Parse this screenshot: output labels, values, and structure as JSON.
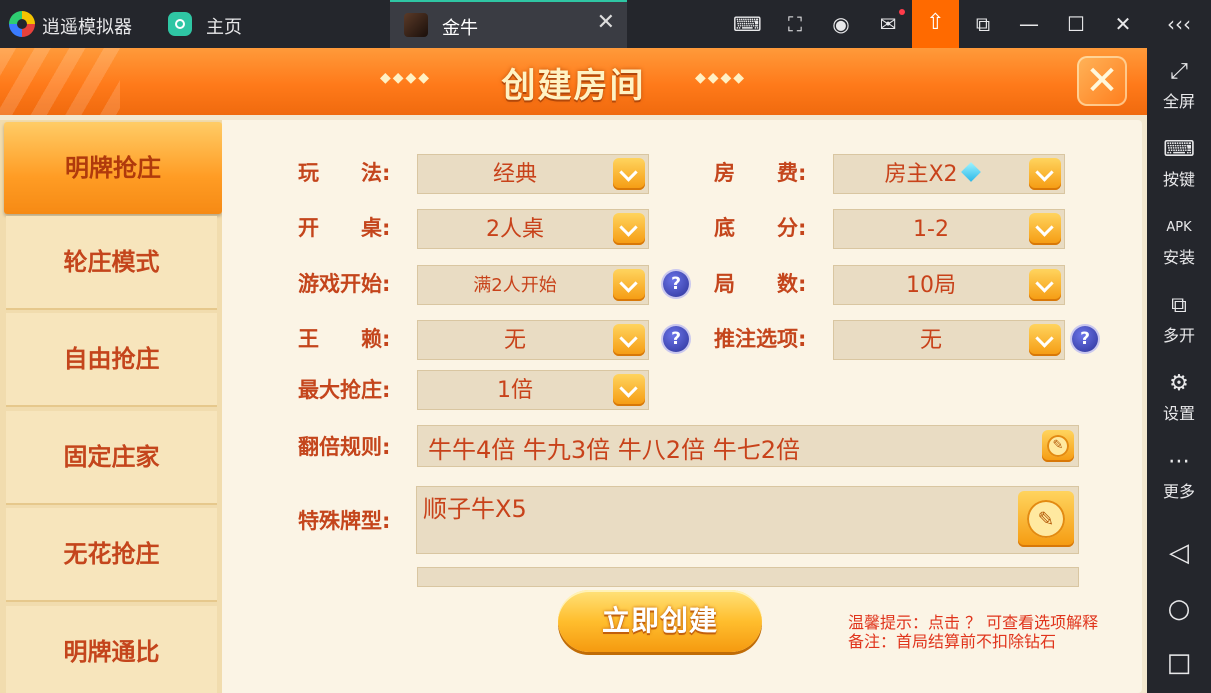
{
  "emulator": {
    "app_name": "逍遥模拟器",
    "home_label": "主页",
    "tab_label": "金牛",
    "sidebar": [
      "全屏",
      "按键",
      "安装",
      "多开",
      "设置",
      "更多"
    ]
  },
  "dialog": {
    "title": "创建房间",
    "title_deco_left": "◆◆◆◆",
    "title_deco_right": "◆◆◆◆"
  },
  "modes": [
    "明牌抢庄",
    "轮庄模式",
    "自由抢庄",
    "固定庄家",
    "无花抢庄",
    "明牌通比"
  ],
  "form": {
    "wanfa": {
      "label": "玩　　法:",
      "value": "经典"
    },
    "fangfei": {
      "label": "房　　费:",
      "value": "房主X2"
    },
    "kaizhuo": {
      "label": "开　　桌:",
      "value": "2人桌"
    },
    "difen": {
      "label": "底　　分:",
      "value": "1-2"
    },
    "start": {
      "label": "游戏开始:",
      "value": "满2人开始"
    },
    "jushu": {
      "label": "局　　数:",
      "value": "10局"
    },
    "wanglai": {
      "label": "王　　赖:",
      "value": "无"
    },
    "tuizhu": {
      "label": "推注选项:",
      "value": "无"
    },
    "qiangzhuang": {
      "label": "最大抢庄:",
      "value": "1倍"
    },
    "fanbei": {
      "label": "翻倍规则:",
      "value": "牛牛4倍 牛九3倍 牛八2倍 牛七2倍"
    },
    "teshu": {
      "label": "特殊牌型:",
      "value": "顺子牛X5"
    },
    "help_mark": "?"
  },
  "create_button": "立即创建",
  "tips": [
    "温馨提示：点击 ？ 可查看选项解释",
    "备注：首局结算前不扣除钻石"
  ],
  "colors": {
    "accent_orange": "#ff7a1a",
    "label_red": "#c4451c",
    "upload_orange": "#ff6a00"
  }
}
